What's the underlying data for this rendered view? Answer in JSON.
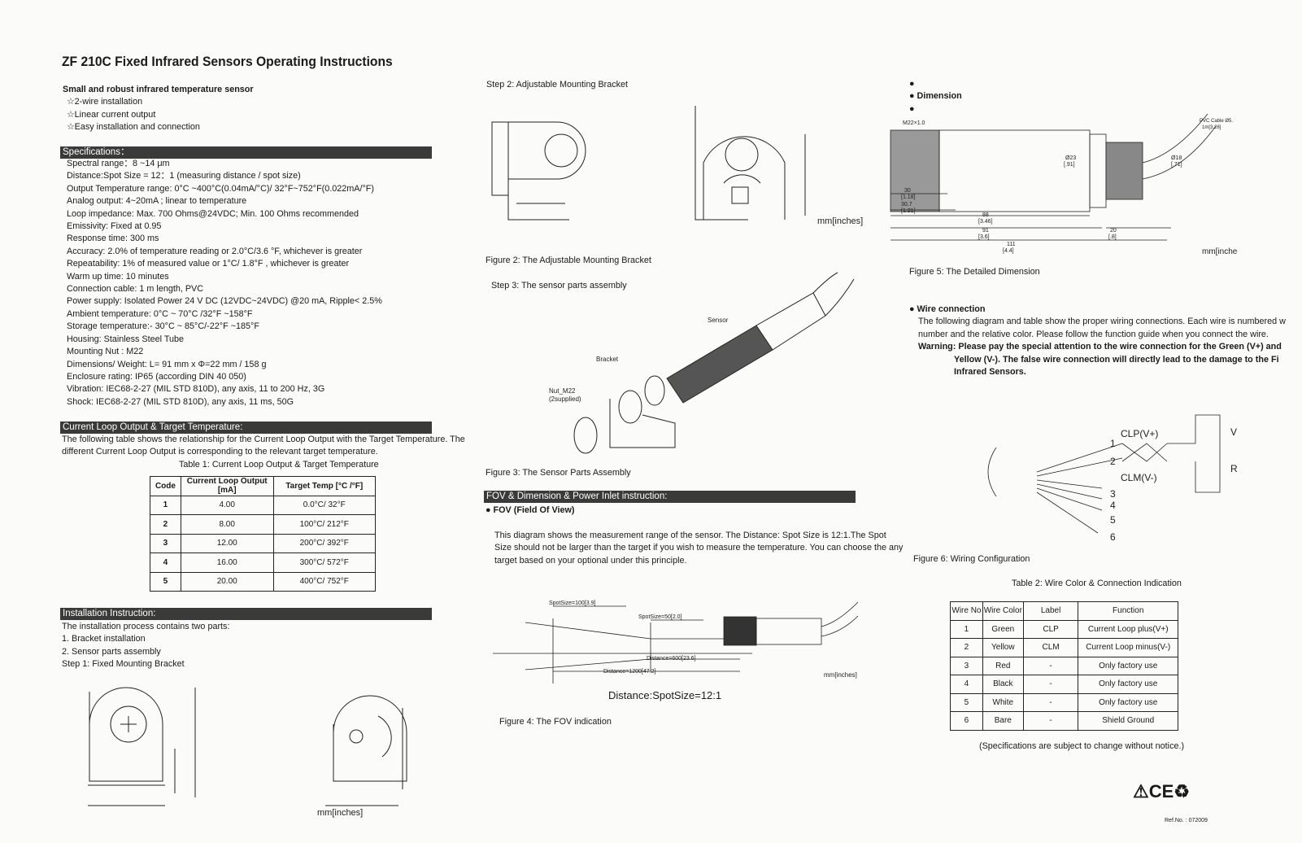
{
  "title": "ZF 210C Fixed Infrared Sensors Operating Instructions",
  "intro": {
    "heading": "Small and robust infrared temperature sensor",
    "features": [
      "☆2-wire installation",
      "☆Linear current output",
      "☆Easy installation and connection"
    ]
  },
  "specifications": {
    "heading": "Specifications：",
    "items": [
      "Spectral range：8 ~14 μm",
      "Distance:Spot Size = 12：1 (measuring distance / spot size)",
      "Output Temperature range:    0°C ~400°C(0.04mA/°C)/ 32°F~752°F(0.022mA/°F)",
      "Analog output: 4~20mA ; linear to temperature",
      "Loop impedance: Max. 700 Ohms@24VDC; Min. 100 Ohms recommended",
      "Emissivity: Fixed at 0.95",
      "Response time: 300 ms",
      "Accuracy: 2.0% of temperature reading or 2.0°C/3.6 °F, whichever is greater",
      "Repeatability: 1% of measured value or 1°C/ 1.8°F , whichever is greater",
      "Warm up time: 10 minutes",
      "Connection cable: 1 m length, PVC",
      "Power supply: Isolated Power 24 V DC (12VDC~24VDC) @20 mA, Ripple< 2.5%",
      "Ambient temperature: 0°C ~ 70°C /32°F ~158°F",
      "Storage temperature:- 30°C ~ 85°C/-22°F ~185°F",
      "Housing: Stainless Steel Tube",
      "Mounting Nut : M22",
      "Dimensions/ Weight: L= 91 mm x Φ=22 mm / 158 g",
      "Enclosure rating: IP65 (according DIN 40 050)",
      "Vibration: IEC68-2-27 (MIL STD 810D), any axis, 11 to 200 Hz, 3G",
      "Shock:    IEC68-2-27 (MIL STD 810D), any axis, 11 ms, 50G"
    ]
  },
  "current_loop": {
    "heading": "Current Loop Output & Target Temperature:",
    "text1": "The following table shows the relationship for the Current Loop Output with the Target Temperature. The",
    "text2": "different Current Loop Output is corresponding to the relevant target temperature.",
    "table_caption": "Table 1: Current Loop Output & Target Temperature",
    "columns": [
      "Code",
      "Current Loop Output [mA]",
      "Target Temp   [°C /°F]"
    ],
    "rows": [
      [
        "1",
        "4.00",
        "0.0°C/ 32°F"
      ],
      [
        "2",
        "8.00",
        "100°C/ 212°F"
      ],
      [
        "3",
        "12.00",
        "200°C/ 392°F"
      ],
      [
        "4",
        "16.00",
        "300°C/ 572°F"
      ],
      [
        "5",
        "20.00",
        "400°C/ 752°F"
      ]
    ]
  },
  "installation": {
    "heading": "Installation Instruction:",
    "lines": [
      "The installation process contains two parts:",
      "1.    Bracket installation",
      "2.    Sensor parts assembly",
      "Step 1: Fixed Mounting Bracket"
    ],
    "units": "mm[inches]"
  },
  "step2": {
    "label": "Step 2: Adjustable Mounting Bracket",
    "units": "mm[inches]",
    "caption": "Figure 2: The Adjustable Mounting Bracket"
  },
  "step3": {
    "label": "Step 3: The sensor parts assembly",
    "parts": [
      "Sensor",
      "Bracket",
      "Nut_M22",
      "(2supplied)"
    ],
    "caption": "Figure 3: The Sensor Parts Assembly"
  },
  "fov": {
    "heading": "FOV & Dimension & Power Inlet instruction:",
    "subheading": "FOV (Field Of View)",
    "text": [
      "This diagram shows the measurement range of the sensor. The Distance: Spot Size is 12:1.The Spot",
      "Size should not be larger than the target if you wish to measure the temperature. You can choose the any",
      "target based on your optional under this principle."
    ],
    "labels": [
      "SpotSize=100[3.9]",
      "SpotSize=50[2.0]",
      "Distance=600[23.6]",
      "Distance=1200[47.2]"
    ],
    "units": "mm[inches]",
    "ratio": "Distance:SpotSize=12:1",
    "caption": "Figure 4: The FOV indication"
  },
  "dimension": {
    "subheading": "Dimension",
    "labels": [
      "M22×1.0",
      "PVC Cable Ø5.",
      "1m[3.28]",
      "Ø23",
      "[.91]",
      "Ø18",
      "[.71]",
      "30",
      "[1.18]",
      "30.7",
      "[1.21]",
      "88",
      "[3.46]",
      "91",
      "[3.6]",
      "111",
      "[4.4]",
      "20",
      "[.8]"
    ],
    "units": "mm[inche",
    "caption": "Figure 5: The Detailed Dimension"
  },
  "wire": {
    "subheading": "Wire connection",
    "text": [
      "The following diagram and table show the proper wiring connections. Each wire is numbered w",
      "number and the relative color. Please follow the function guide when you connect the wire."
    ],
    "warning_label": "Warning:",
    "warning": [
      "Please pay the special attention to the wire connection for the Green (V+) and",
      "Yellow (V-). The false wire connection will directly lead to the damage to the Fi",
      "Infrared Sensors."
    ],
    "diagram": {
      "clp": "CLP(V+)",
      "clm": "CLM(V-)",
      "v": "V",
      "r": "R",
      "numbers": [
        "1",
        "2",
        "3",
        "4",
        "5",
        "6"
      ]
    },
    "caption": "Figure 6: Wiring Configuration",
    "table_caption": "Table 2: Wire Color & Connection Indication",
    "columns": [
      "Wire No",
      "Wire Color",
      "Label",
      "Function"
    ],
    "rows": [
      [
        "1",
        "Green",
        "CLP",
        "Current Loop plus(V+)"
      ],
      [
        "2",
        "Yellow",
        "CLM",
        "Current Loop minus(V-)"
      ],
      [
        "3",
        "Red",
        "-",
        "Only factory use"
      ],
      [
        "4",
        "Black",
        "-",
        "Only factory use"
      ],
      [
        "5",
        "White",
        "-",
        "Only factory use"
      ],
      [
        "6",
        "Bare",
        "-",
        "Shield Ground"
      ]
    ],
    "note": "(Specifications are subject to change without notice.)"
  },
  "footer": {
    "marks": "⚠CE♻",
    "ref": "Ref.No. : 072009"
  }
}
